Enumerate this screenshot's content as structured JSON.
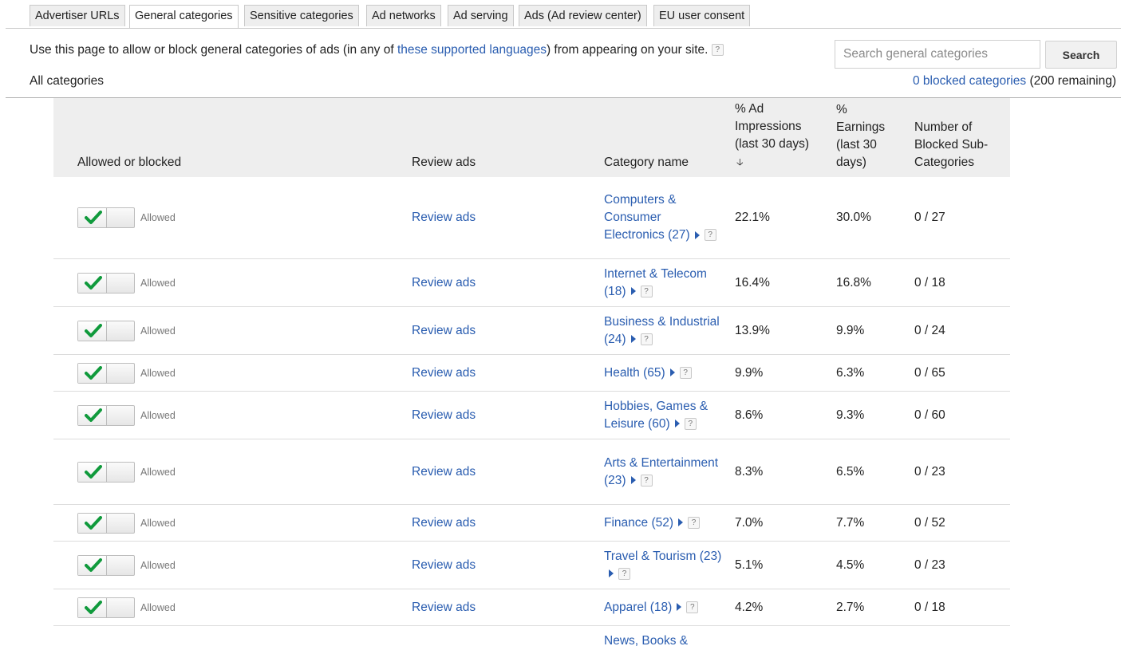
{
  "tabs": [
    {
      "label": "Advertiser URLs",
      "active": false
    },
    {
      "label": "General categories",
      "active": true
    },
    {
      "label": "Sensitive categories",
      "active": false
    },
    {
      "label": "Ad networks",
      "active": false
    },
    {
      "label": "Ad serving",
      "active": false
    },
    {
      "label": "Ads (Ad review center)",
      "active": false
    },
    {
      "label": "EU user consent",
      "active": false
    }
  ],
  "intro": {
    "before": "Use this page to allow or block general categories of ads (in any of ",
    "link": "these supported languages",
    "after": ") from appearing on your site.",
    "help": "?"
  },
  "search": {
    "placeholder": "Search general categories",
    "button": "Search"
  },
  "all_categories": "All categories",
  "blocked": {
    "link": "0 blocked categories",
    "remaining": "(200 remaining)"
  },
  "table": {
    "headers": {
      "allowed": "Allowed or blocked",
      "review": "Review ads",
      "category": "Category name",
      "impressions": [
        "% Ad",
        "Impressions",
        "(last 30 days)"
      ],
      "sort_arrow": "🡣",
      "earnings": [
        "%",
        "Earnings",
        "(last 30",
        "days)"
      ],
      "blocked_sub": [
        "Number of",
        "Blocked Sub-",
        "Categories"
      ]
    },
    "rows": [
      {
        "status": "Allowed",
        "review": "Review ads",
        "category": "Computers & Consumer Electronics (27)",
        "impressions": "22.1%",
        "earnings": "30.0%",
        "blocked": "0 / 27"
      },
      {
        "status": "Allowed",
        "review": "Review ads",
        "category": "Internet & Telecom (18)",
        "impressions": "16.4%",
        "earnings": "16.8%",
        "blocked": "0 / 18"
      },
      {
        "status": "Allowed",
        "review": "Review ads",
        "category": "Business & Industrial (24)",
        "impressions": "13.9%",
        "earnings": "9.9%",
        "blocked": "0 / 24"
      },
      {
        "status": "Allowed",
        "review": "Review ads",
        "category": "Health (65)",
        "impressions": "9.9%",
        "earnings": "6.3%",
        "blocked": "0 / 65"
      },
      {
        "status": "Allowed",
        "review": "Review ads",
        "category": "Hobbies, Games & Leisure (60)",
        "impressions": "8.6%",
        "earnings": "9.3%",
        "blocked": "0 / 60"
      },
      {
        "status": "Allowed",
        "review": "Review ads",
        "category": "Arts & Entertainment (23)",
        "impressions": "8.3%",
        "earnings": "6.5%",
        "blocked": "0 / 23"
      },
      {
        "status": "Allowed",
        "review": "Review ads",
        "category": "Finance (52)",
        "impressions": "7.0%",
        "earnings": "7.7%",
        "blocked": "0 / 52"
      },
      {
        "status": "Allowed",
        "review": "Review ads",
        "category": "Travel & Tourism (23)",
        "impressions": "5.1%",
        "earnings": "4.5%",
        "blocked": "0 / 23"
      },
      {
        "status": "Allowed",
        "review": "Review ads",
        "category": "Apparel (18)",
        "impressions": "4.2%",
        "earnings": "2.7%",
        "blocked": "0 / 18"
      }
    ],
    "partial_row_category": "News, Books &"
  }
}
